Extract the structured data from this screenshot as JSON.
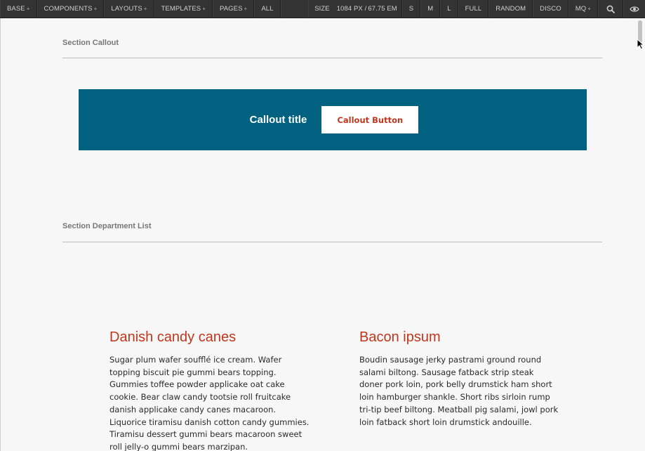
{
  "toolbar": {
    "menus": [
      {
        "label": "BASE",
        "plus": "+"
      },
      {
        "label": "COMPONENTS",
        "plus": "+"
      },
      {
        "label": "LAYOUTS",
        "plus": "+"
      },
      {
        "label": "TEMPLATES",
        "plus": "+"
      },
      {
        "label": "PAGES",
        "plus": "+"
      },
      {
        "label": "ALL",
        "plus": ""
      }
    ],
    "size_label": "SIZE",
    "size_px": "1084 PX /",
    "size_em": "67.75 EM",
    "buttons": [
      "S",
      "M",
      "L",
      "FULL",
      "RANDOM",
      "DISCO"
    ],
    "mq": {
      "label": "MQ",
      "plus": "+"
    },
    "icons": {
      "search": "search-icon",
      "eye": "eye-icon"
    }
  },
  "callout_section": {
    "label": "Section Callout",
    "title": "Callout title",
    "button_label": "Callout Button",
    "bg_color": "#006280",
    "button_text_color": "#c0361c"
  },
  "department_section": {
    "label": "Section Department List",
    "items": [
      {
        "title": "Danish candy canes",
        "body": "Sugar plum wafer soufflé ice cream. Wafer topping biscuit pie gummi bears topping. Gummies toffee powder applicake oat cake cookie. Bear claw candy tootsie roll fruitcake danish applicake candy canes macaroon. Liquorice tiramisu danish cotton candy gummies. Tiramisu dessert gummi bears macaroon sweet roll jelly-o gummi bears marzipan."
      },
      {
        "title": "Bacon ipsum",
        "body": "Boudin sausage jerky pastrami ground round salami biltong. Sausage fatback strip steak doner pork loin, pork belly drumstick ham short loin hamburger shankle. Short ribs sirloin rump tri-tip beef biltong. Meatball pig salami, jowl pork loin fatback short loin drumstick andouille."
      }
    ],
    "title_color": "#c0361c"
  }
}
